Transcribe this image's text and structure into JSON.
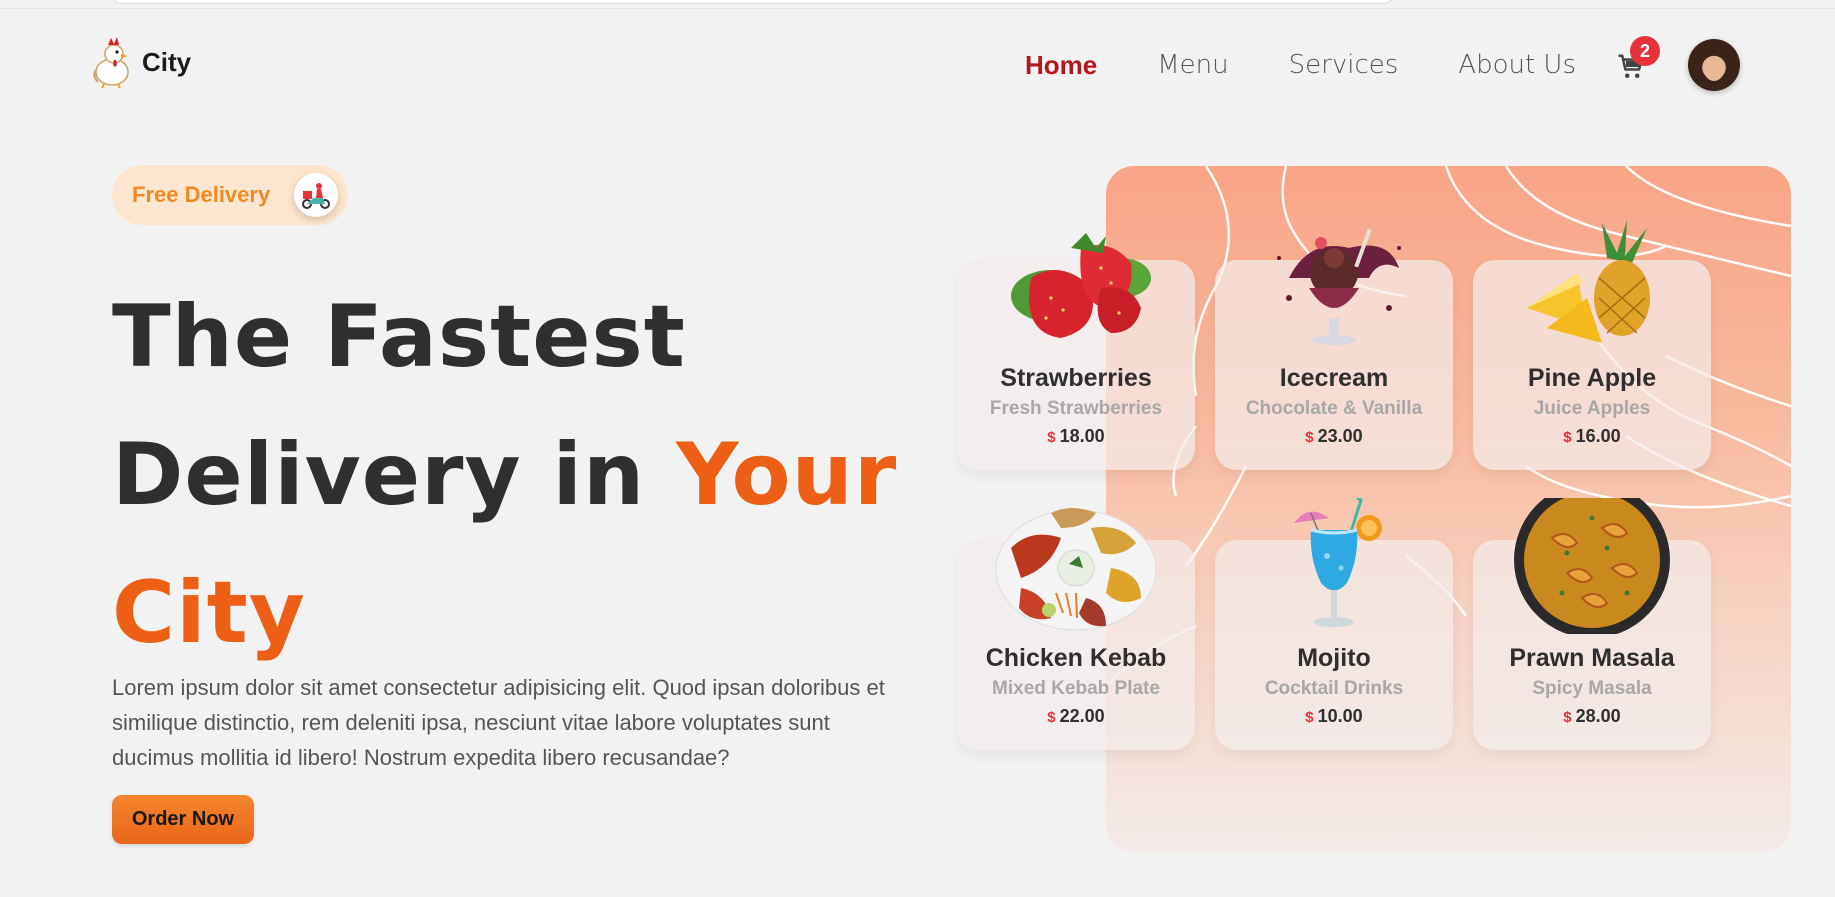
{
  "header": {
    "logo_text": "City",
    "nav": [
      {
        "label": "Home",
        "active": true
      },
      {
        "label": "Menu",
        "active": false
      },
      {
        "label": "Services",
        "active": false
      },
      {
        "label": "About Us",
        "active": false
      }
    ],
    "cart_count": "2"
  },
  "hero": {
    "badge_label": "Free Delivery",
    "headline_line1": "The Fastest",
    "headline_line2a": "Delivery in ",
    "headline_line2b": "Your",
    "headline_line3": "City",
    "description": "Lorem ipsum dolor sit amet consectetur adipisicing elit. Quod ipsan doloribus et similique distinctio, rem deleniti ipsa, nesciunt vitae labore voluptates sunt ducimus mollitia id libero! Nostrum expedita libero recusandae?",
    "order_button": "Order Now"
  },
  "colors": {
    "accent": "#ec5f14",
    "active_nav": "#b3171d",
    "badge_bg": "#fde6cf",
    "currency": "#e8323a"
  },
  "menu_cards": [
    {
      "name": "Strawberries",
      "subtitle": "Fresh Strawberries",
      "currency": "$",
      "price": "18.00",
      "image": "strawberries-image"
    },
    {
      "name": "Icecream",
      "subtitle": "Chocolate & Vanilla",
      "currency": "$",
      "price": "23.00",
      "image": "icecream-image"
    },
    {
      "name": "Pine Apple",
      "subtitle": "Juice Apples",
      "currency": "$",
      "price": "16.00",
      "image": "pineapple-image"
    },
    {
      "name": "Chicken Kebab",
      "subtitle": "Mixed Kebab Plate",
      "currency": "$",
      "price": "22.00",
      "image": "kebab-image"
    },
    {
      "name": "Mojito",
      "subtitle": "Cocktail Drinks",
      "currency": "$",
      "price": "10.00",
      "image": "mojito-image"
    },
    {
      "name": "Prawn Masala",
      "subtitle": "Spicy Masala",
      "currency": "$",
      "price": "28.00",
      "image": "prawn-masala-image"
    }
  ]
}
